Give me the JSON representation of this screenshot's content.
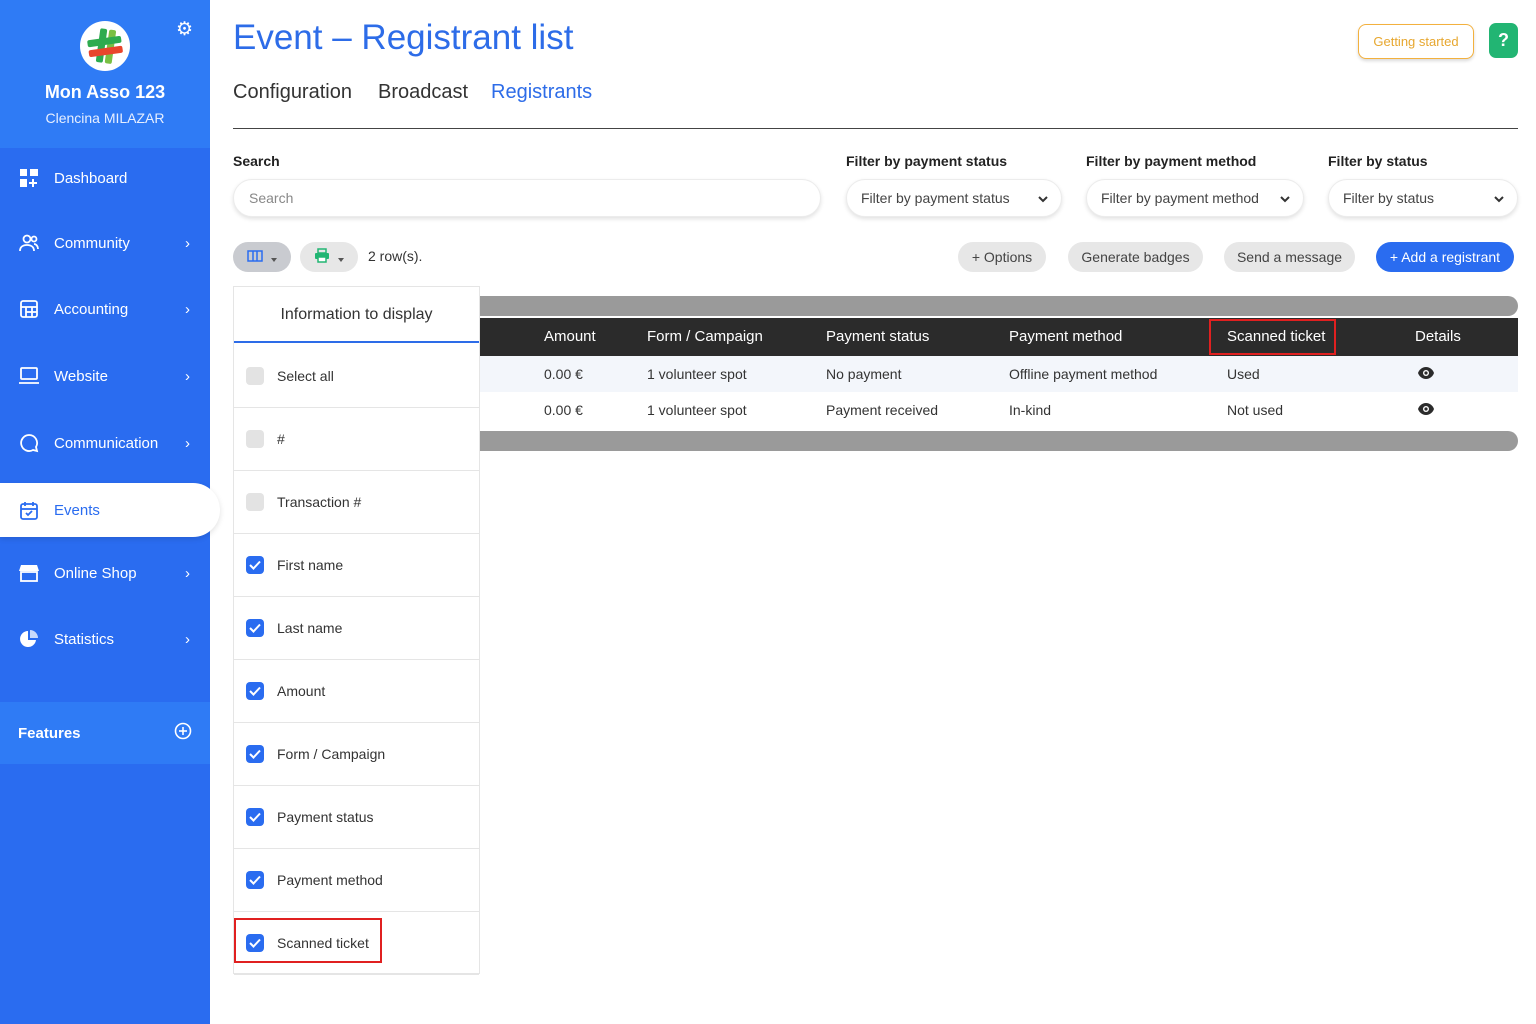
{
  "org": {
    "name": "Mon Asso 123",
    "user": "Clencina MILAZAR"
  },
  "sidebar": {
    "items": [
      {
        "label": "Dashboard",
        "icon": "dashboard-icon",
        "chevron": false
      },
      {
        "label": "Community",
        "icon": "community-icon",
        "chevron": true
      },
      {
        "label": "Accounting",
        "icon": "accounting-icon",
        "chevron": true
      },
      {
        "label": "Website",
        "icon": "website-icon",
        "chevron": true
      },
      {
        "label": "Communication",
        "icon": "communication-icon",
        "chevron": true
      },
      {
        "label": "Events",
        "icon": "events-icon",
        "chevron": false,
        "active": true
      },
      {
        "label": "Online Shop",
        "icon": "shop-icon",
        "chevron": true
      },
      {
        "label": "Statistics",
        "icon": "statistics-icon",
        "chevron": true
      }
    ],
    "features_label": "Features",
    "chevron": "›"
  },
  "header": {
    "title": "Event – Registrant list",
    "getting_started": "Getting started",
    "help": "?"
  },
  "tabs": [
    "Configuration",
    "Broadcast",
    "Registrants"
  ],
  "filters": {
    "search_label": "Search",
    "search_placeholder": "Search",
    "payment_status_label": "Filter by payment status",
    "payment_status_value": "Filter by payment status",
    "payment_method_label": "Filter by payment method",
    "payment_method_value": "Filter by payment method",
    "status_label": "Filter by status",
    "status_value": "Filter by status"
  },
  "toolbar": {
    "rows": "2 row(s).",
    "options": "+ Options",
    "badges": "Generate badges",
    "message": "Send a message",
    "add": "+ Add a registrant"
  },
  "table": {
    "headers": [
      "Amount",
      "Form / Campaign",
      "Payment status",
      "Payment method",
      "Scanned ticket",
      "Details"
    ],
    "rows": [
      [
        "0.00 €",
        "1 volunteer spot",
        "No payment",
        "Offline payment method",
        "Used"
      ],
      [
        "0.00 €",
        "1 volunteer spot",
        "Payment received",
        "In-kind",
        "Not used"
      ]
    ]
  },
  "columns_panel": {
    "title": "Information to display",
    "items": [
      {
        "label": "Select all",
        "checked": false
      },
      {
        "label": "#",
        "checked": false
      },
      {
        "label": "Transaction #",
        "checked": false
      },
      {
        "label": "First name",
        "checked": true
      },
      {
        "label": "Last name",
        "checked": true
      },
      {
        "label": "Amount",
        "checked": true
      },
      {
        "label": "Form / Campaign",
        "checked": true
      },
      {
        "label": "Payment status",
        "checked": true
      },
      {
        "label": "Payment method",
        "checked": true
      },
      {
        "label": "Scanned ticket",
        "checked": true
      }
    ]
  },
  "colors": {
    "primary": "#2a6cf0",
    "accent_green": "#22b573",
    "warning": "#f3b13e",
    "highlight": "#e02020"
  }
}
